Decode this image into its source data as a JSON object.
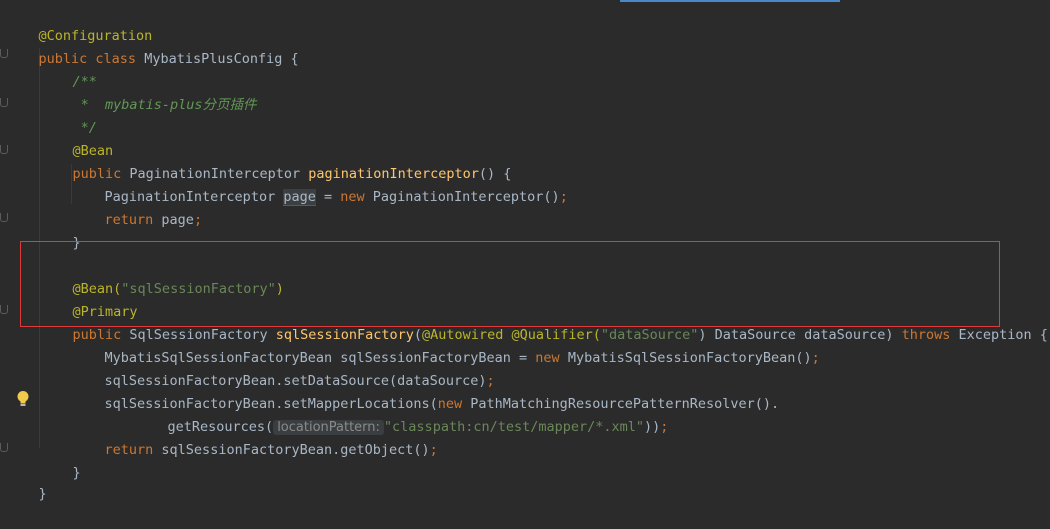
{
  "lines": {
    "l1": {
      "ann": "@Configuration"
    },
    "l2": {
      "kw1": "public class ",
      "name": "MybatisPlusConfig",
      "brace": " {"
    },
    "l3": {
      "text": "/**"
    },
    "l4": {
      "text": " *  mybatis-plus分页插件"
    },
    "l5": {
      "text": " */"
    },
    "l6": {
      "ann": "@Bean"
    },
    "l7": {
      "kw": "public ",
      "type": "PaginationInterceptor ",
      "fn": "paginationInterceptor",
      "rest": "() {"
    },
    "l8": {
      "type": "PaginationInterceptor ",
      "var": "page",
      "eq": " = ",
      "kw": "new ",
      "ctor": "PaginationInterceptor()",
      "semi": ";"
    },
    "l9": {
      "kw": "return ",
      "var": "page",
      "semi": ";"
    },
    "l10": {
      "brace": "}"
    },
    "l11": {
      "ann": "@Bean(",
      "str": "\"sqlSessionFactory\"",
      "close": ")"
    },
    "l12": {
      "ann": "@Primary"
    },
    "l13": {
      "kw": "public ",
      "type": "SqlSessionFactory ",
      "fn": "sqlSessionFactory",
      "p1": "(",
      "ann1": "@Autowired ",
      "ann2": "@Qualifier(",
      "str": "\"dataSource\"",
      "p2": ") DataSource dataSource) ",
      "kw2": "throws ",
      "exc": "Exception {"
    },
    "l14": {
      "type": "MybatisSqlSessionFactoryBean sqlSessionFactoryBean = ",
      "kw": "new ",
      "ctor": "MybatisSqlSessionFactoryBean()",
      "semi": ";"
    },
    "l15": {
      "text": "sqlSessionFactoryBean.setDataSource(dataSource)",
      "semi": ";"
    },
    "l16": {
      "text": "sqlSessionFactoryBean.setMapperLocations(",
      "kw": "new ",
      "rest": "PathMatchingResourcePatternResolver()."
    },
    "l17": {
      "text": "getResources(",
      "hint": "locationPattern:",
      "str": "\"classpath:cn/test/mapper/*.xml\"",
      "close": "))",
      "semi": ";"
    },
    "l18": {
      "kw": "return ",
      "text": "sqlSessionFactoryBean.getObject()",
      "semi": ";"
    },
    "l19": {
      "brace": "}"
    },
    "l20": {
      "brace": "}"
    }
  },
  "icons": {
    "bulb": "lightbulb-icon"
  },
  "colors": {
    "background": "#2b2b2b",
    "keyword": "#cc7832",
    "annotation": "#bbb529",
    "string": "#6a8759",
    "comment": "#629755",
    "method": "#ffc66d",
    "highlight_border": "#e03b3b"
  }
}
